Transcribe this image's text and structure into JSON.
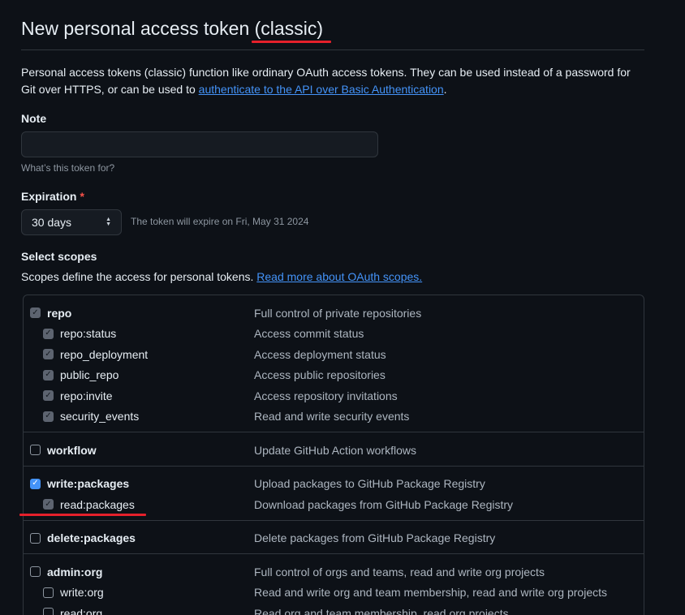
{
  "header": {
    "title": "New personal access token (classic)"
  },
  "intro": {
    "text_before": "Personal access tokens (classic) function like ordinary OAuth access tokens. They can be used instead of a password for Git over HTTPS, or can be used to ",
    "link": "authenticate to the API over Basic Authentication",
    "text_after": "."
  },
  "note": {
    "label": "Note",
    "value": "",
    "placeholder": "",
    "hint": "What’s this token for?"
  },
  "expiration": {
    "label": "Expiration",
    "required_mark": "*",
    "selected": "30 days",
    "hint": "The token will expire on Fri, May 31 2024"
  },
  "scopes": {
    "label": "Select scopes",
    "desc": "Scopes define the access for personal tokens. ",
    "link": "Read more about OAuth scopes.",
    "groups": [
      {
        "items": [
          {
            "name": "repo",
            "desc": "Full control of private repositories",
            "level": "parent",
            "state": "checked-gray"
          },
          {
            "name": "repo:status",
            "desc": "Access commit status",
            "level": "child",
            "state": "checked-gray"
          },
          {
            "name": "repo_deployment",
            "desc": "Access deployment status",
            "level": "child",
            "state": "checked-gray"
          },
          {
            "name": "public_repo",
            "desc": "Access public repositories",
            "level": "child",
            "state": "checked-gray"
          },
          {
            "name": "repo:invite",
            "desc": "Access repository invitations",
            "level": "child",
            "state": "checked-gray"
          },
          {
            "name": "security_events",
            "desc": "Read and write security events",
            "level": "child",
            "state": "checked-gray"
          }
        ]
      },
      {
        "items": [
          {
            "name": "workflow",
            "desc": "Update GitHub Action workflows",
            "level": "parent",
            "state": "unchecked"
          }
        ]
      },
      {
        "items": [
          {
            "name": "write:packages",
            "desc": "Upload packages to GitHub Package Registry",
            "level": "parent",
            "state": "checked-blue"
          },
          {
            "name": "read:packages",
            "desc": "Download packages from GitHub Package Registry",
            "level": "child",
            "state": "checked-gray"
          }
        ]
      },
      {
        "items": [
          {
            "name": "delete:packages",
            "desc": "Delete packages from GitHub Package Registry",
            "level": "parent",
            "state": "unchecked"
          }
        ]
      },
      {
        "items": [
          {
            "name": "admin:org",
            "desc": "Full control of orgs and teams, read and write org projects",
            "level": "parent",
            "state": "unchecked"
          },
          {
            "name": "write:org",
            "desc": "Read and write org and team membership, read and write org projects",
            "level": "child",
            "state": "unchecked"
          },
          {
            "name": "read:org",
            "desc": "Read org and team membership, read org projects",
            "level": "child",
            "state": "unchecked"
          }
        ]
      }
    ]
  },
  "colors": {
    "background": "#0d1117",
    "link": "#4493f8",
    "annotation_red": "#e5202b",
    "checkbox_blue": "#4493f8"
  },
  "icons": {
    "check": "check-icon",
    "select_arrows": "chevron-up-down-icon"
  }
}
